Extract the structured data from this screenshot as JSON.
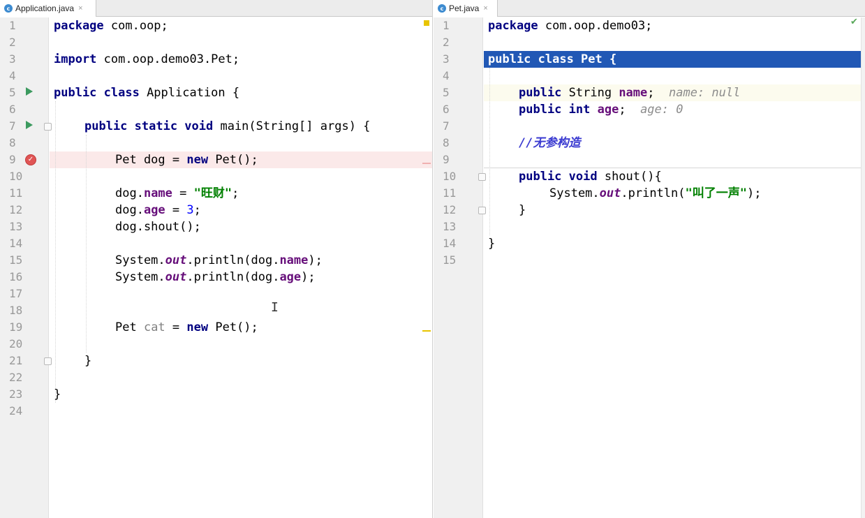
{
  "left_editor": {
    "tab_label": "Application.java",
    "tab_icon": "c",
    "tab_close": "×",
    "line_numbers": [
      "1",
      "2",
      "3",
      "4",
      "5",
      "6",
      "7",
      "8",
      "9",
      "10",
      "11",
      "12",
      "13",
      "14",
      "15",
      "16",
      "17",
      "18",
      "19",
      "20",
      "21",
      "22",
      "23",
      "24"
    ],
    "code": {
      "l1_kw": "package",
      "l1_rest": " com.oop;",
      "l3_kw": "import",
      "l3_rest": " com.oop.demo03.Pet;",
      "l5_kw": "public class",
      "l5_rest": " Application {",
      "l7_kw": "public static void",
      "l7_rest": " main(String[] args) {",
      "l9_a": "Pet dog = ",
      "l9_kw": "new",
      "l9_b": " Pet();",
      "l11_a": "dog.",
      "l11_fld": "name",
      "l11_b": " = ",
      "l11_str": "\"旺财\"",
      "l11_c": ";",
      "l12_a": "dog.",
      "l12_fld": "age",
      "l12_b": " = ",
      "l12_num": "3",
      "l12_c": ";",
      "l13": "dog.shout();",
      "l15_a": "System.",
      "l15_static": "out",
      "l15_b": ".println(dog.",
      "l15_fld": "name",
      "l15_c": ");",
      "l16_a": "System.",
      "l16_static": "out",
      "l16_b": ".println(dog.",
      "l16_fld": "age",
      "l16_c": ");",
      "l19_a": "Pet ",
      "l19_unused": "cat",
      "l19_b": " = ",
      "l19_kw": "new",
      "l19_c": " Pet();",
      "l21": "}",
      "l23": "}"
    },
    "breakpoint_glyph": "✓"
  },
  "right_editor": {
    "tab_label": "Pet.java",
    "tab_icon": "c",
    "tab_close": "×",
    "line_numbers": [
      "1",
      "2",
      "3",
      "4",
      "5",
      "6",
      "7",
      "8",
      "9",
      "10",
      "11",
      "12",
      "13",
      "14",
      "15"
    ],
    "code": {
      "l1_kw": "package",
      "l1_rest": " com.oop.demo03;",
      "l3": "public class Pet {",
      "l5_kw": "public",
      "l5_a": " String ",
      "l5_fld": "name",
      "l5_b": ";",
      "l5_hint": "name: null",
      "l6_kw": "public int",
      "l6_a": " ",
      "l6_fld": "age",
      "l6_b": ";",
      "l6_hint": "age: 0",
      "l8_cmt": "//无参构造",
      "l10_kw": "public void",
      "l10_rest": " shout(){",
      "l11_a": "System.",
      "l11_static": "out",
      "l11_b": ".println(",
      "l11_str": "\"叫了一声\"",
      "l11_c": ");",
      "l12": "}",
      "l14": "}"
    },
    "inspection_ok": "✔"
  },
  "cursor_glyph": "I",
  "colors": {
    "keyword": "#000080",
    "field": "#660e7a",
    "string": "#008000",
    "selection": "#2158b5",
    "breakpoint": "#e05555"
  }
}
